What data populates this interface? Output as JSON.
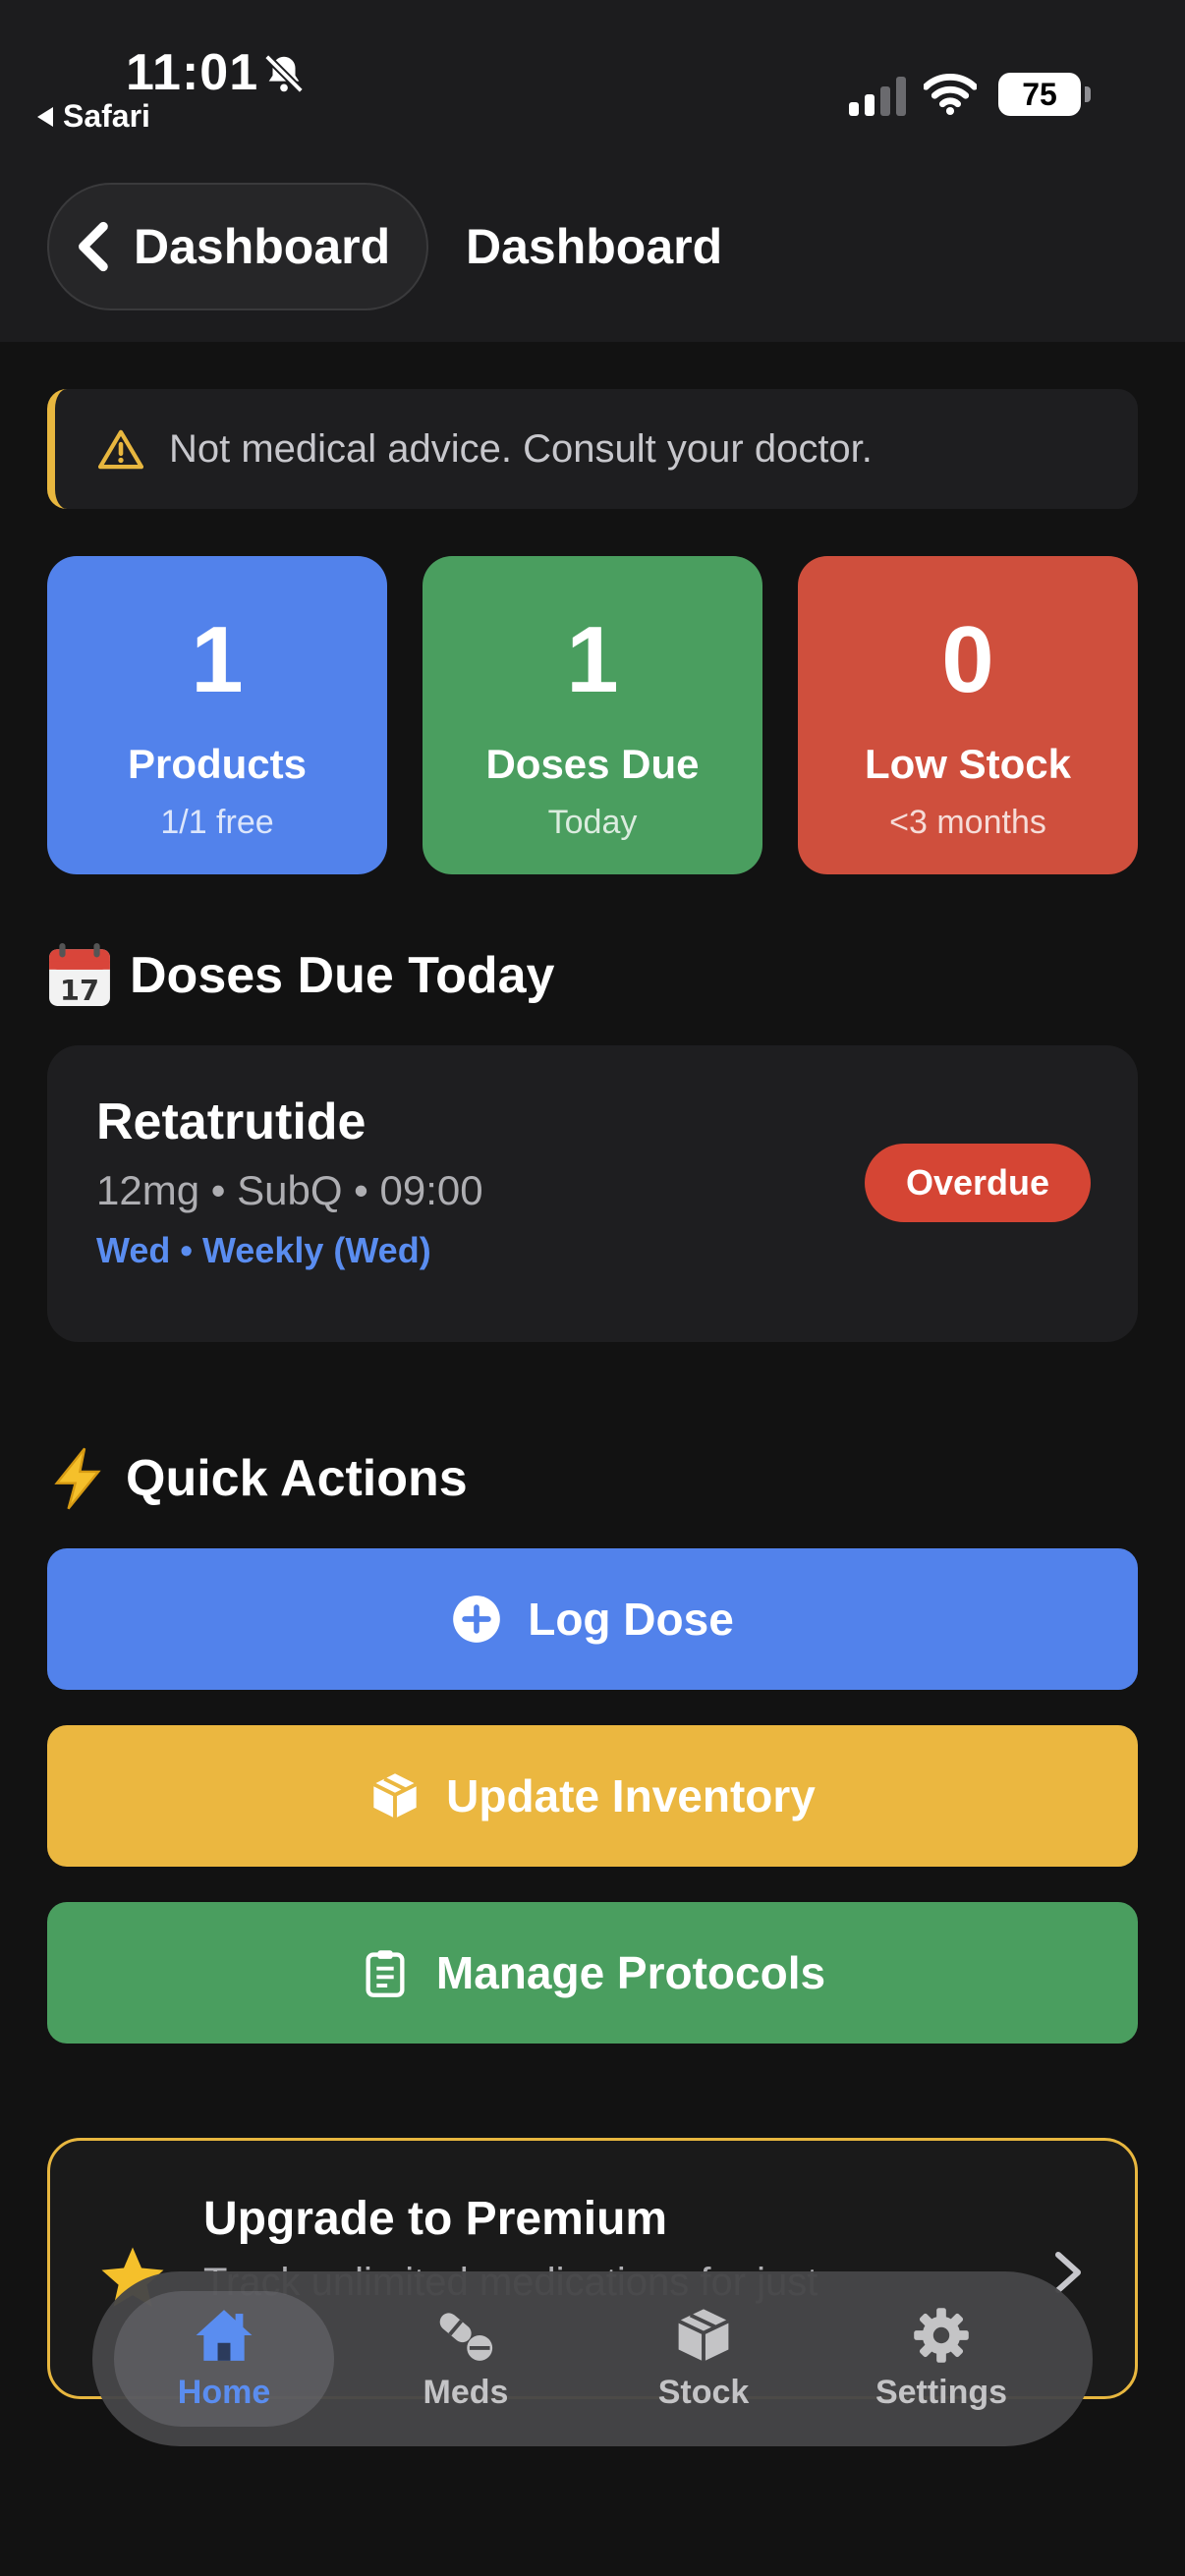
{
  "status_bar": {
    "time": "11:01",
    "back_app": "Safari",
    "battery": "75"
  },
  "header": {
    "back_label": "Dashboard",
    "title": "Dashboard"
  },
  "disclaimer": {
    "text": "Not medical advice. Consult your doctor.",
    "accent_color": "#e8b73f"
  },
  "stats": [
    {
      "value": "1",
      "label": "Products",
      "sub": "1/1 free",
      "color": "#5282eb"
    },
    {
      "value": "1",
      "label": "Doses Due",
      "sub": "Today",
      "color": "#4a9e5f"
    },
    {
      "value": "0",
      "label": "Low Stock",
      "sub": "<3 months",
      "color": "#cf4f3d"
    }
  ],
  "doses_section": {
    "title": "Doses Due Today",
    "icon": "calendar-icon",
    "items": [
      {
        "name": "Retatrutide",
        "detail": "12mg • SubQ • 09:00",
        "schedule": "Wed • Weekly (Wed)",
        "status": "Overdue"
      }
    ]
  },
  "quick_actions": {
    "title": "Quick Actions",
    "icon": "lightning-icon",
    "buttons": [
      {
        "label": "Log Dose",
        "icon": "plus-circle-icon",
        "color": "#5282eb"
      },
      {
        "label": "Update Inventory",
        "icon": "box-icon",
        "color": "#ebb740"
      },
      {
        "label": "Manage Protocols",
        "icon": "clipboard-icon",
        "color": "#4a9e5f"
      }
    ]
  },
  "premium": {
    "title": "Upgrade to Premium",
    "subtitle": "Track unlimited medications for just",
    "icon": "star-icon"
  },
  "tabbar": {
    "active": "Home",
    "accent_color": "#5a8df0",
    "tabs": [
      {
        "label": "Home",
        "icon": "home-icon"
      },
      {
        "label": "Meds",
        "icon": "pills-icon"
      },
      {
        "label": "Stock",
        "icon": "box-icon"
      },
      {
        "label": "Settings",
        "icon": "gear-icon"
      }
    ]
  }
}
